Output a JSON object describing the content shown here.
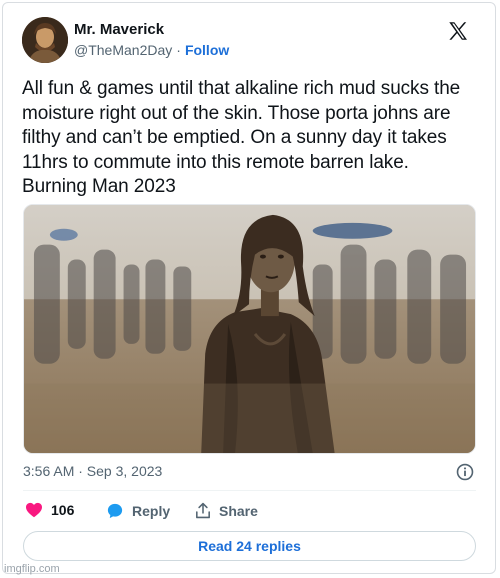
{
  "author": {
    "name": "Mr. Maverick",
    "handle": "@TheMan2Day",
    "separator": "·",
    "follow_label": "Follow",
    "avatar_icon": "avatar"
  },
  "platform_icon": "x-logo-icon",
  "tweet": {
    "lines": [
      "All fun & games until that alkaline rich mud sucks the",
      "moisture right out of the skin. Those porta johns are",
      "filthy and can’t be emptied. On a sunny day it takes",
      "11hrs to commute into this remote barren lake.",
      "Burning Man 2023"
    ]
  },
  "timestamp": "3:56 AM · Sep 3, 2023",
  "actions": {
    "like_count": "106",
    "reply_label": "Reply",
    "share_label": "Share"
  },
  "read_replies_label": "Read 24 replies",
  "watermark": "imgflip.com",
  "colors": {
    "link_blue": "#1d6fd8",
    "like_pink": "#f91880",
    "text_secondary": "#536471"
  }
}
